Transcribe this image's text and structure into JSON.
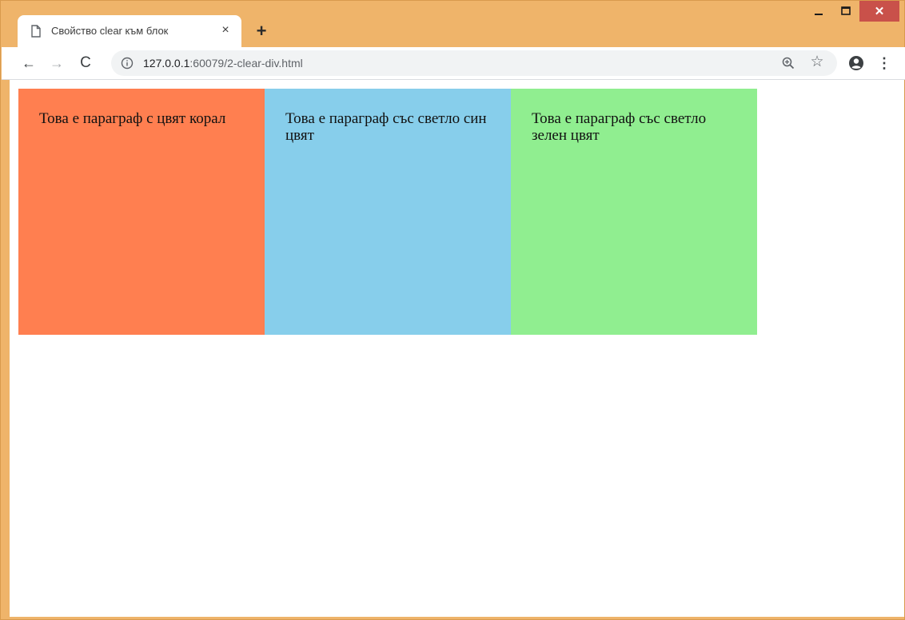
{
  "tab": {
    "title": "Свойство clear към блок",
    "close": "×"
  },
  "new_tab": "+",
  "window_controls": {
    "minimize": "—",
    "maximize": "☐",
    "close": "✕"
  },
  "toolbar": {
    "back": "←",
    "forward": "→",
    "reload": "C",
    "url_host": "127.0.0.1",
    "url_rest": ":60079/2-clear-div.html",
    "star": "☆",
    "menu": "⋮"
  },
  "blocks": [
    {
      "text": "Това е параграф с цвят корал",
      "color": "#ff7f50"
    },
    {
      "text": "Това е параграф със светло син цвят",
      "color": "#87ceeb"
    },
    {
      "text": "Това е параграф със светло зелен цвят",
      "color": "#90ee90"
    }
  ],
  "colors": {
    "frame": "#efb46a",
    "close_button": "#c9514a"
  }
}
